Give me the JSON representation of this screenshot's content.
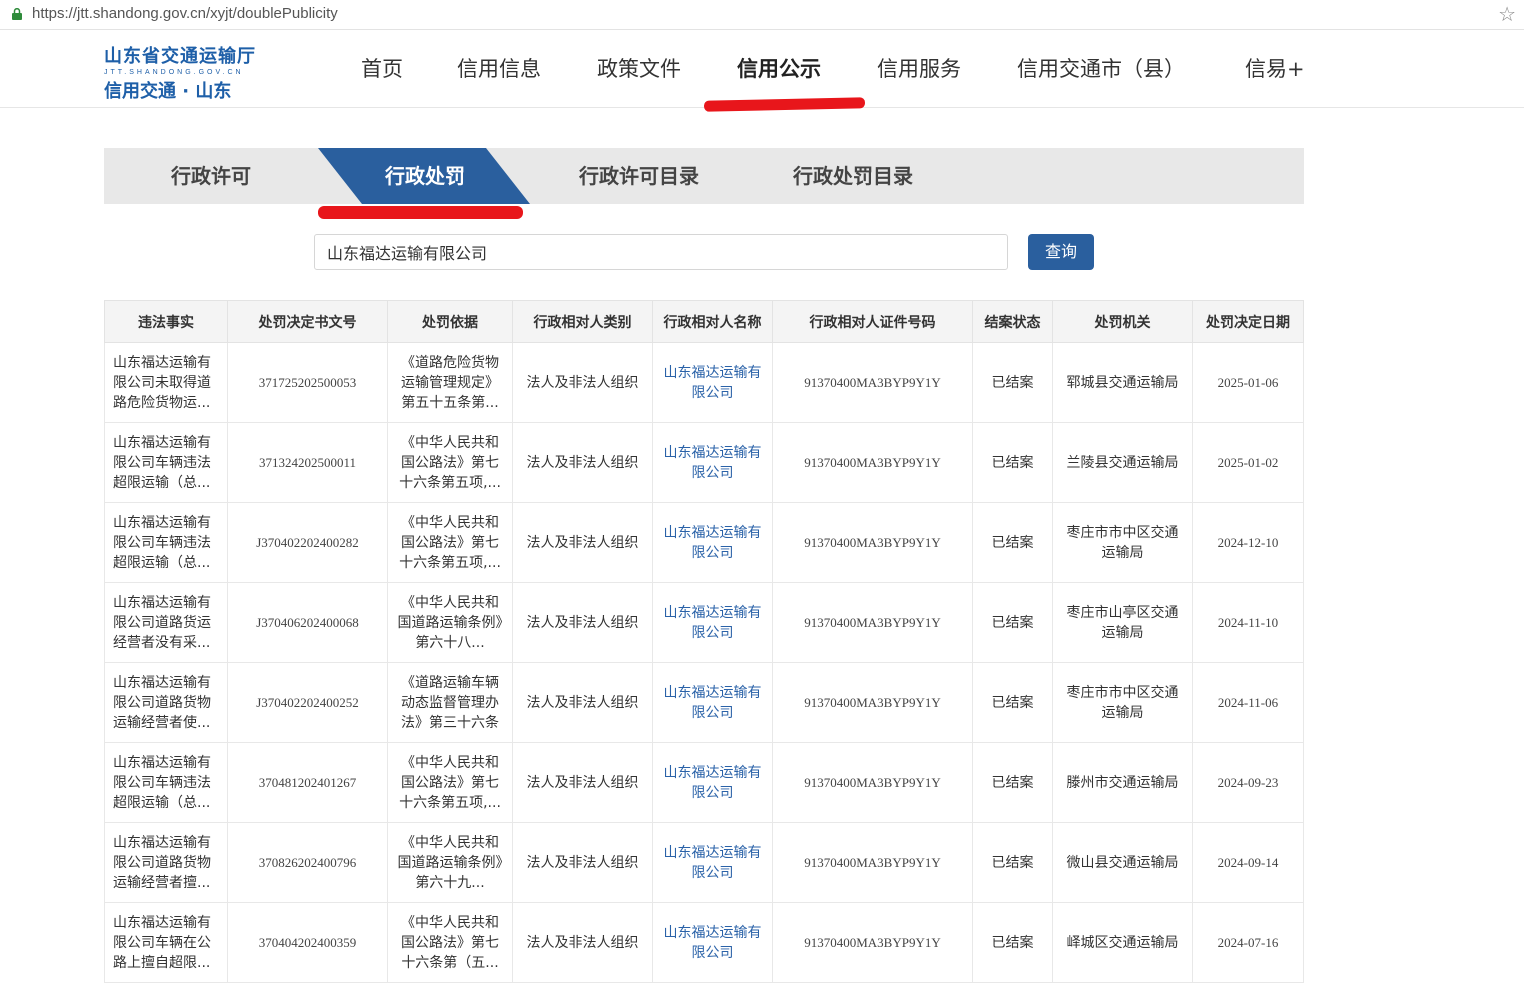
{
  "browser": {
    "url": "https://jtt.shandong.gov.cn/xyjt/doublePublicity"
  },
  "logo": {
    "line1": "山东省交通运输厅",
    "line2": "JTT.SHANDONG.GOV.CN",
    "line3": "信用交通 · 山东"
  },
  "nav": [
    "首页",
    "信用信息",
    "政策文件",
    "信用公示",
    "信用服务",
    "信用交通市（县）",
    "信易+"
  ],
  "tabs": [
    "行政许可",
    "行政处罚",
    "行政许可目录",
    "行政处罚目录"
  ],
  "search": {
    "value": "山东福达运输有限公司",
    "button": "查询"
  },
  "table": {
    "headers": [
      "违法事实",
      "处罚决定书文号",
      "处罚依据",
      "行政相对人类别",
      "行政相对人名称",
      "行政相对人证件号码",
      "结案状态",
      "处罚机关",
      "处罚决定日期"
    ],
    "rows": [
      [
        "山东福达运输有限公司未取得道路危险货物运...",
        "371725202500053",
        "《道路危险货物运输管理规定》第五十五条第...",
        "法人及非法人组织",
        "山东福达运输有限公司",
        "91370400MA3BYP9Y1Y",
        "已结案",
        "郓城县交通运输局",
        "2025-01-06"
      ],
      [
        "山东福达运输有限公司车辆违法超限运输（总...",
        "371324202500011",
        "《中华人民共和国公路法》第七十六条第五项,...",
        "法人及非法人组织",
        "山东福达运输有限公司",
        "91370400MA3BYP9Y1Y",
        "已结案",
        "兰陵县交通运输局",
        "2025-01-02"
      ],
      [
        "山东福达运输有限公司车辆违法超限运输（总...",
        "J370402202400282",
        "《中华人民共和国公路法》第七十六条第五项,...",
        "法人及非法人组织",
        "山东福达运输有限公司",
        "91370400MA3BYP9Y1Y",
        "已结案",
        "枣庄市市中区交通运输局",
        "2024-12-10"
      ],
      [
        "山东福达运输有限公司道路货运经营者没有采...",
        "J370406202400068",
        "《中华人民共和国道路运输条例》第六十八...",
        "法人及非法人组织",
        "山东福达运输有限公司",
        "91370400MA3BYP9Y1Y",
        "已结案",
        "枣庄市山亭区交通运输局",
        "2024-11-10"
      ],
      [
        "山东福达运输有限公司道路货物运输经营者使...",
        "J370402202400252",
        "《道路运输车辆动态监督管理办法》第三十六条",
        "法人及非法人组织",
        "山东福达运输有限公司",
        "91370400MA3BYP9Y1Y",
        "已结案",
        "枣庄市市中区交通运输局",
        "2024-11-06"
      ],
      [
        "山东福达运输有限公司车辆违法超限运输（总...",
        "370481202401267",
        "《中华人民共和国公路法》第七十六条第五项,...",
        "法人及非法人组织",
        "山东福达运输有限公司",
        "91370400MA3BYP9Y1Y",
        "已结案",
        "滕州市交通运输局",
        "2024-09-23"
      ],
      [
        "山东福达运输有限公司道路货物运输经营者擅...",
        "370826202400796",
        "《中华人民共和国道路运输条例》第六十九...",
        "法人及非法人组织",
        "山东福达运输有限公司",
        "91370400MA3BYP9Y1Y",
        "已结案",
        "微山县交通运输局",
        "2024-09-14"
      ],
      [
        "山东福达运输有限公司车辆在公路上擅自超限...",
        "370404202400359",
        "《中华人民共和国公路法》第七十六条第（五...",
        "法人及非法人组织",
        "山东福达运输有限公司",
        "91370400MA3BYP9Y1Y",
        "已结案",
        "峄城区交通运输局",
        "2024-07-16"
      ]
    ]
  },
  "colors": {
    "brand": "#1e5fa8",
    "button": "#2a5f9e",
    "link": "#2a62a8",
    "highlight_mark": "#e8161b",
    "tab_bar": "#e8e8e8"
  }
}
